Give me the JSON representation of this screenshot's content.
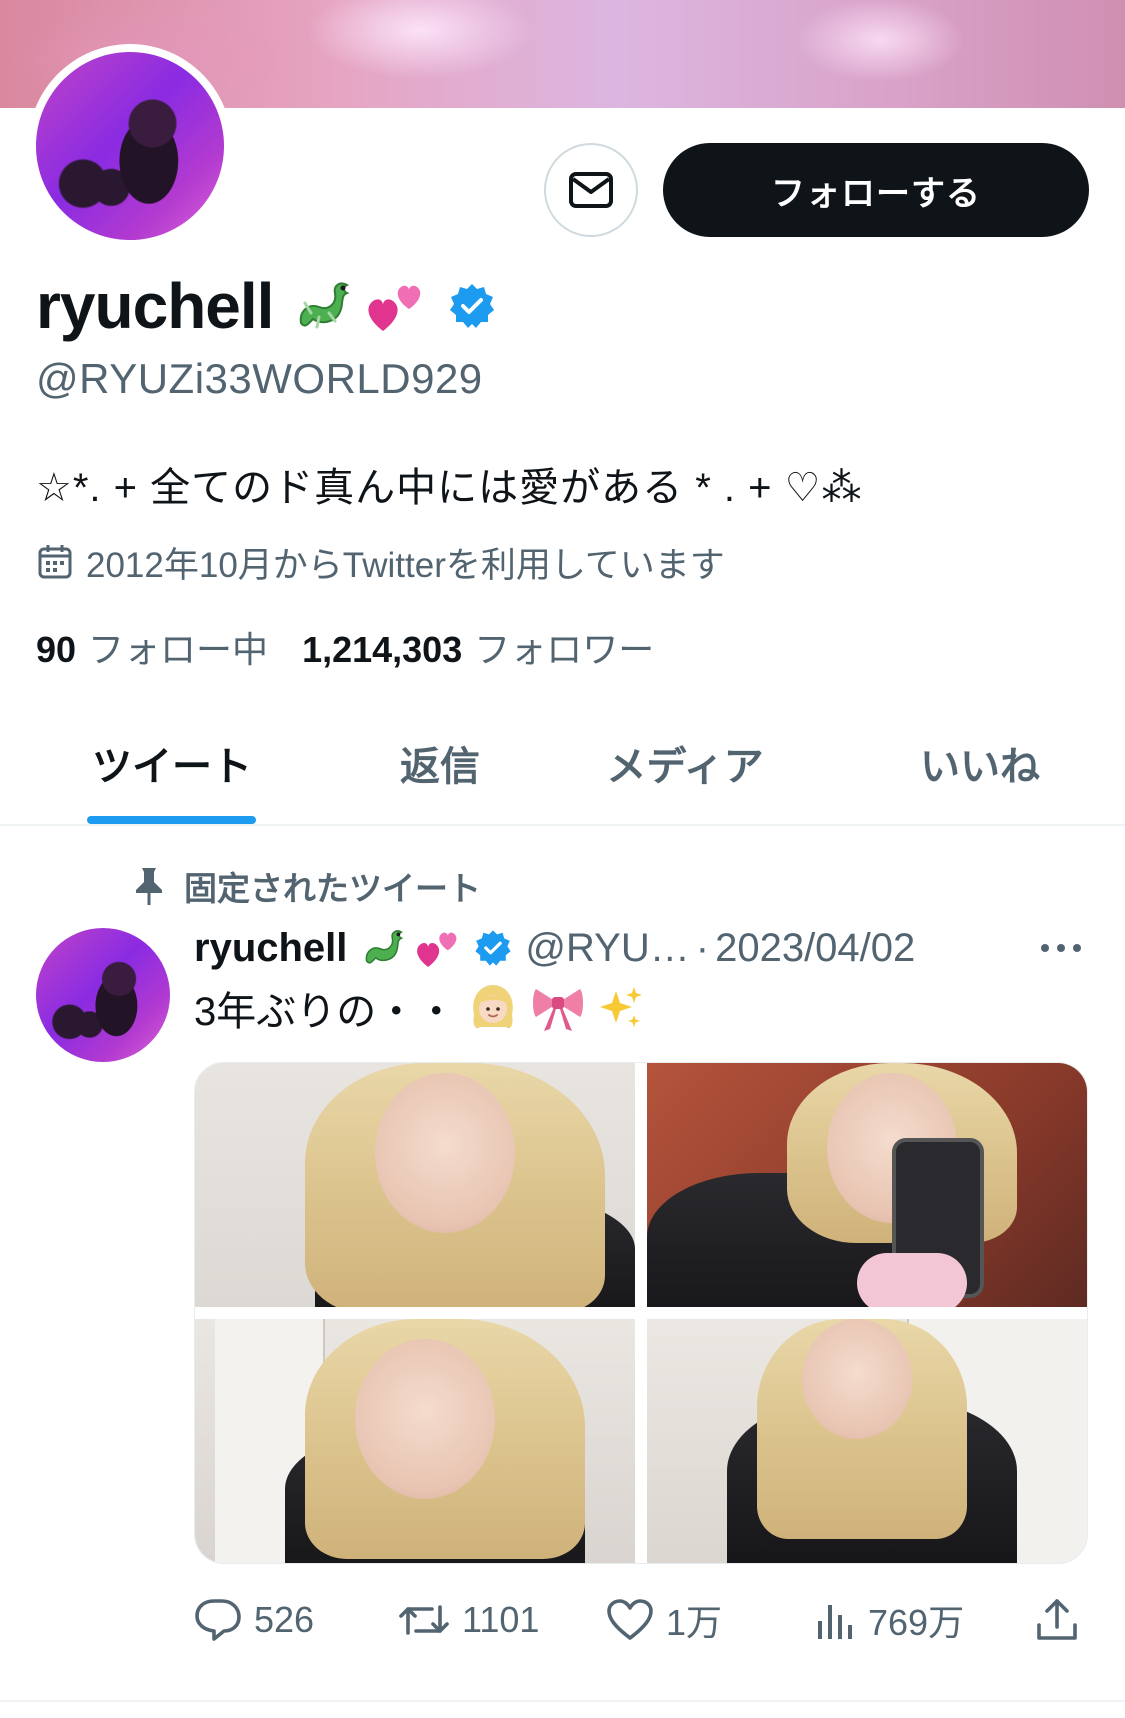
{
  "colors": {
    "accent": "#1d9bf0",
    "text_primary": "#0f1419",
    "text_secondary": "#536471",
    "follow_button_bg": "#0f1419",
    "verified": "#1d9bf0"
  },
  "header": {
    "message_icon": "envelope-icon",
    "follow_label": "フォローする"
  },
  "profile": {
    "name": "ryuchell",
    "name_emojis": [
      "🐉",
      "💕"
    ],
    "verified_icon": "verified-badge-icon",
    "handle": "@RYUZi33WORLD929",
    "bio": "☆*. + 全てのド真ん中には愛がある * . + ♡⁂",
    "joined_icon": "calendar-icon",
    "joined": "2012年10月からTwitterを利用しています",
    "following_count": "90",
    "following_label": "フォロー中",
    "followers_count": "1,214,303",
    "followers_label": "フォロワー"
  },
  "tabs": [
    {
      "label": "ツイート",
      "active": true
    },
    {
      "label": "返信",
      "active": false
    },
    {
      "label": "メディア",
      "active": false
    },
    {
      "label": "いいね",
      "active": false
    }
  ],
  "tweet": {
    "pinned_icon": "pin-icon",
    "pinned_label": "固定されたツイート",
    "author_name": "ryuchell",
    "author_emojis": [
      "🐉",
      "💕"
    ],
    "author_handle": "@RYU…",
    "dot": "·",
    "date": "2023/04/02",
    "more_icon": "more-horizontal-icon",
    "text": "3年ぶりの・・",
    "text_emojis": [
      "👱🏻‍♀️",
      "🎀",
      "✨"
    ],
    "media_count": 4,
    "actions": {
      "reply_icon": "reply-icon",
      "replies": "526",
      "retweet_icon": "retweet-icon",
      "retweets": "1101",
      "like_icon": "heart-icon",
      "likes": "1万",
      "views_icon": "views-icon",
      "views": "769万",
      "share_icon": "share-icon"
    }
  }
}
